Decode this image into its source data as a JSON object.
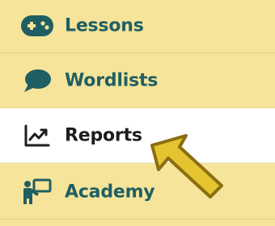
{
  "colors": {
    "background": "#f6e49a",
    "active_background": "#ffffff",
    "nav_text": "#1f5f63",
    "active_text": "#1d1d1d",
    "pointer_arrow_fill": "#e4c431",
    "pointer_arrow_outline": "#8a6e10"
  },
  "nav": {
    "items": [
      {
        "label": "Lessons",
        "icon": "gamepad-icon",
        "active": false
      },
      {
        "label": "Wordlists",
        "icon": "speech-bubble-icon",
        "active": false
      },
      {
        "label": "Reports",
        "icon": "line-chart-icon",
        "active": true
      },
      {
        "label": "Academy",
        "icon": "teacher-board-icon",
        "active": false
      }
    ]
  },
  "annotation": {
    "icon": "pointer-arrow-icon"
  }
}
